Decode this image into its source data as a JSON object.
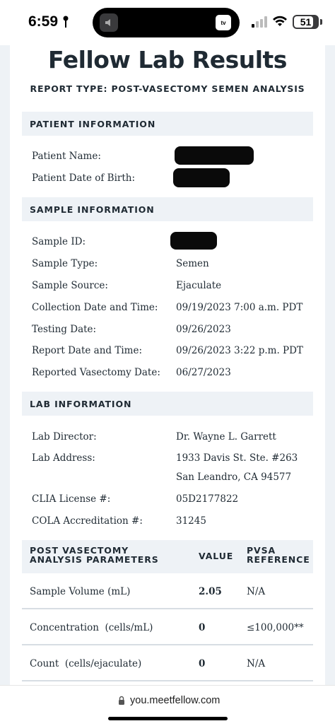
{
  "status_bar": {
    "time": "6:59",
    "battery": "51",
    "island_app": "tv"
  },
  "page": {
    "title": "Fellow Lab Results",
    "report_type": "REPORT TYPE: POST-VASECTOMY SEMEN ANALYSIS"
  },
  "patient_info": {
    "header": "PATIENT INFORMATION",
    "rows": [
      {
        "label": "Patient Name:",
        "value": ""
      },
      {
        "label": "Patient Date of Birth:",
        "value": ""
      }
    ]
  },
  "sample_info": {
    "header": "SAMPLE INFORMATION",
    "rows": [
      {
        "label": "Sample ID:",
        "value": ""
      },
      {
        "label": "Sample Type:",
        "value": "Semen"
      },
      {
        "label": "Sample Source:",
        "value": "Ejaculate"
      },
      {
        "label": "Collection Date and Time:",
        "value": "09/19/2023 7:00 a.m. PDT"
      },
      {
        "label": "Testing Date:",
        "value": "09/26/2023"
      },
      {
        "label": "Report Date and Time:",
        "value": "09/26/2023 3:22 p.m. PDT"
      },
      {
        "label": "Reported Vasectomy Date:",
        "value": "06/27/2023"
      }
    ]
  },
  "lab_info": {
    "header": "LAB INFORMATION",
    "director_label": "Lab Director:",
    "director_value": "Dr. Wayne L. Garrett",
    "address_label": "Lab Address:",
    "address_line1": "1933 Davis St. Ste. #263",
    "address_line2": "San Leandro, CA 94577",
    "clia_label": "CLIA License #:",
    "clia_value": "05D2177822",
    "cola_label": "COLA Accreditation #:",
    "cola_value": "31245"
  },
  "parameters": {
    "header_param": "POST VASECTOMY ANALYSIS PARAMETERS",
    "header_value": "VALUE",
    "header_ref": "PVSA REFERENCE",
    "rows": [
      {
        "name": "Sample Volume (mL)",
        "value": "2.05",
        "ref": "N/A"
      },
      {
        "name": "Concentration  (cells/mL)",
        "value": "0",
        "ref": "≤100,000**"
      },
      {
        "name": "Count  (cells/ejaculate)",
        "value": "0",
        "ref": "N/A"
      }
    ]
  },
  "url_bar": {
    "url": "you.meetfellow.com"
  }
}
